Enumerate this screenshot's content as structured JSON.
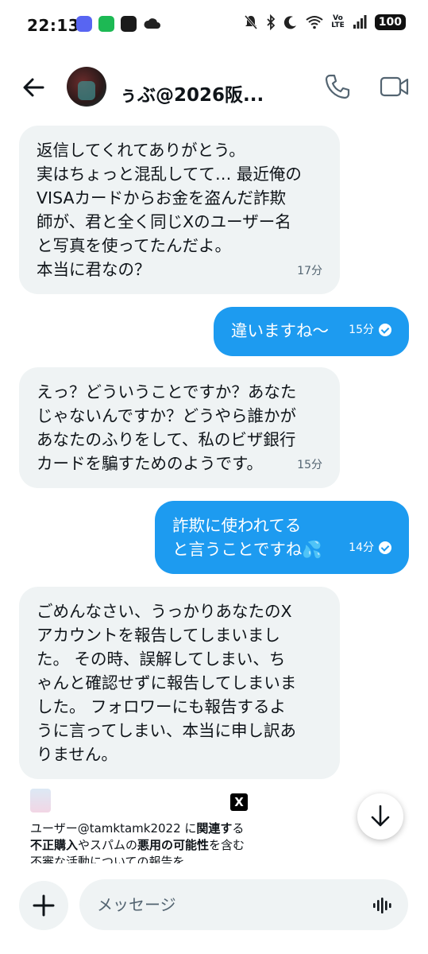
{
  "status_bar": {
    "time": "22:13",
    "volte_top": "Vo",
    "volte_bottom": "LTE",
    "battery": "100"
  },
  "header": {
    "contact_name": "ぅぶ@2026阪..."
  },
  "messages": [
    {
      "direction": "incoming",
      "text": "返信してくれてありがとう。\n実はちょっと混乱してて… 最近俺の\nVISAカードからお金を盗んだ詐欺\n師が、君と全く同じXのユーザー名\nと写真を使ってたんだよ。\n本当に君なの？",
      "time": "17分"
    },
    {
      "direction": "outgoing",
      "text": "違いますね〜",
      "time": "15分"
    },
    {
      "direction": "incoming",
      "text": "えっ？どういうことですか？あなた\nじゃないんですか？どうやら誰かが\nあなたのふりをして、私のビザ銀行\nカードを騙すためのようです。",
      "time": "15分"
    },
    {
      "direction": "outgoing",
      "text": "詐欺に使われてる\nと言うことですね💦",
      "time": "14分"
    },
    {
      "direction": "incoming",
      "text": "ごめんなさい、うっかりあなたのX\nアカウントを報告してしまいまし\nた。 その時、誤解してしまい、ち\nゃんと確認せずに報告してしまいま\nした。 フォロワーにも報告するよ\nうに言ってしまい、本当に申し訳あ\nりません。",
      "time": ""
    }
  ],
  "card": {
    "text_part1": "ユーザー@tamktamk2022 に",
    "text_bold1": "関連す",
    "text_part2": "る",
    "text_bold2": "不正購入",
    "text_part3": "やスパムの",
    "text_bold3": "悪用の可能性",
    "text_part4": "を含む不審な活動についての報告を"
  },
  "composer": {
    "placeholder": "メッセージ"
  },
  "colors": {
    "outgoing_bubble": "#1d9bf0",
    "incoming_bubble": "#eff3f4"
  }
}
